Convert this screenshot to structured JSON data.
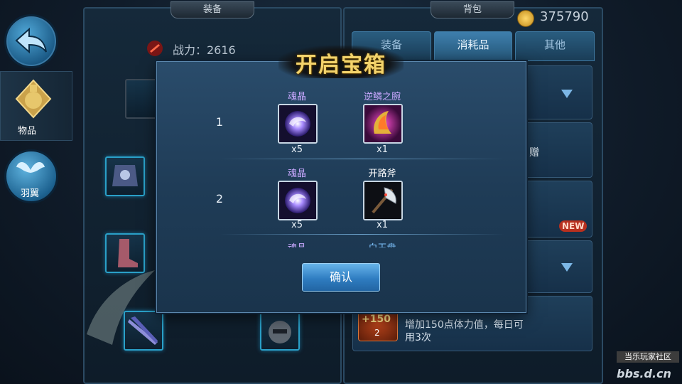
{
  "nav": {
    "items_label": "物品",
    "wings_label": "羽翼"
  },
  "equip_panel": {
    "tag": "装备",
    "power_label": "战力：2616"
  },
  "bag_panel": {
    "tag": "背包",
    "gold": "375790",
    "tabs": [
      "装备",
      "消耗品",
      "其他"
    ],
    "active_tab": "消耗品",
    "item_gift_text": "赠",
    "new_badge": "NEW",
    "stamina_badge": "+150",
    "stamina_count": "2",
    "stamina_desc_1": "增加150点体力值，每日可",
    "stamina_desc_2": "用3次"
  },
  "dialog": {
    "title": "开启宝箱",
    "rows": [
      {
        "index": "1",
        "rewards": [
          {
            "name": "魂晶",
            "qty": "x5",
            "color": "#c9a8ff",
            "icon": "soul-crystal-icon"
          },
          {
            "name": "逆鳞之腕",
            "qty": "x1",
            "color": "#c9a8ff",
            "icon": "bracer-icon"
          }
        ]
      },
      {
        "index": "2",
        "rewards": [
          {
            "name": "魂晶",
            "qty": "x5",
            "color": "#c9a8ff",
            "icon": "soul-crystal-icon"
          },
          {
            "name": "开路斧",
            "qty": "x1",
            "color": "#ffffff",
            "icon": "axe-icon"
          }
        ]
      }
    ],
    "partial_row": {
      "left": "魂晶",
      "right": "白玉盘"
    },
    "confirm_label": "确认"
  },
  "watermark": {
    "line1": "当乐玩家社区",
    "line2": "bbs.d.cn"
  },
  "colors": {
    "title_gold": "#f3d36b",
    "purple_name": "#c9a8ff",
    "blue_name": "#7fc4ff"
  }
}
